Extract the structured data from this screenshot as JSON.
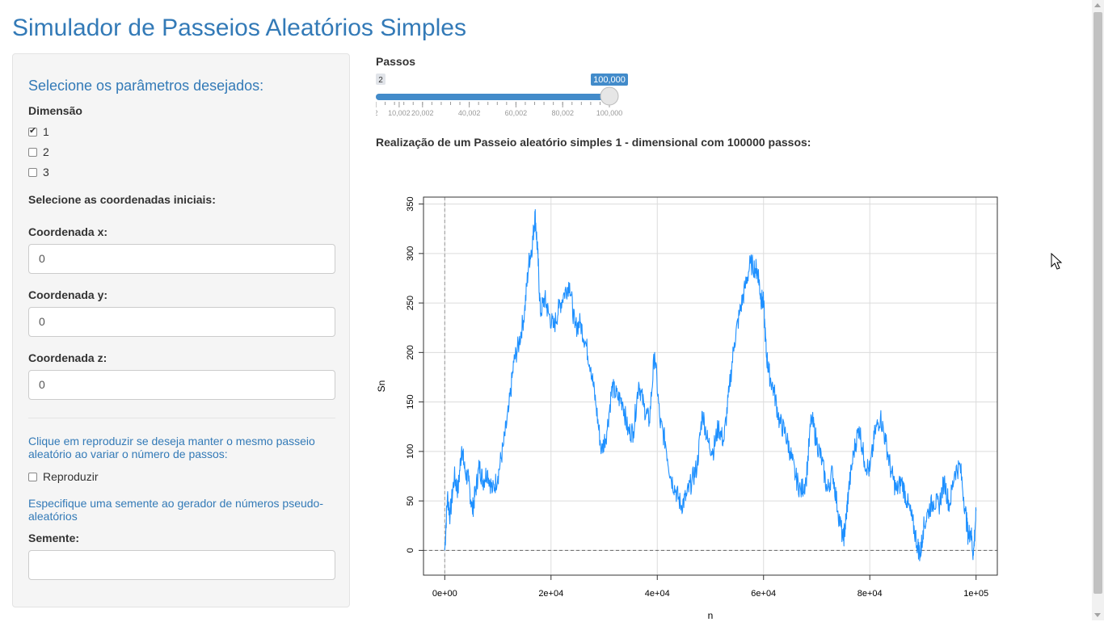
{
  "page": {
    "title": "Simulador de Passeios Aleatórios Simples"
  },
  "sidebar": {
    "heading": "Selecione os parâmetros desejados:",
    "dimension_label": "Dimensão",
    "dimensions": [
      {
        "label": "1",
        "checked": true
      },
      {
        "label": "2",
        "checked": false
      },
      {
        "label": "3",
        "checked": false
      }
    ],
    "coords_heading": "Selecione as coordenadas iniciais:",
    "coord_x": {
      "label": "Coordenada x:",
      "value": "0"
    },
    "coord_y": {
      "label": "Coordenada y:",
      "value": "0"
    },
    "coord_z": {
      "label": "Coordenada z:",
      "value": "0"
    },
    "reproduce_help": "Clique em reproduzir se deseja manter o mesmo passeio aleatório ao variar o número de passos:",
    "reproduce_label": "Reproduzir",
    "seed_help": "Especifique uma semente ao gerador de números pseudo-aleatórios",
    "seed_label": "Semente:",
    "seed_value": ""
  },
  "slider": {
    "label": "Passos",
    "min_badge": "2",
    "value_badge": "100,000",
    "min": 2,
    "max": 100000,
    "value": 100000,
    "accent": "#428bca",
    "ticks": [
      "2",
      "10,002",
      "20,002",
      "40,002",
      "60,002",
      "80,002",
      "100,000"
    ]
  },
  "plot_title": "Realização de um Passeio aleatório simples 1 - dimensional com 100000 passos:",
  "chart_data": {
    "type": "line",
    "xlabel": "n",
    "ylabel": "Sn",
    "xlim": [
      -4000,
      104000
    ],
    "ylim": [
      -25,
      357
    ],
    "x_ticks": [
      "0e+00",
      "2e+04",
      "4e+04",
      "6e+04",
      "8e+04",
      "1e+05"
    ],
    "x_tick_values": [
      0,
      20000,
      40000,
      60000,
      80000,
      100000
    ],
    "y_ticks": [
      "0",
      "50",
      "100",
      "150",
      "200",
      "250",
      "300",
      "350"
    ],
    "y_tick_values": [
      0,
      50,
      100,
      150,
      200,
      250,
      300,
      350
    ],
    "grid": true,
    "reference_lines": {
      "horizontal_dashed_at": 0,
      "vertical_dashed_at": 0
    },
    "color": "#1e90ff",
    "series": [
      {
        "x": [
          0,
          500,
          1000,
          1800,
          2500,
          3200,
          3800,
          4500,
          5200,
          5800,
          6500,
          7200,
          8000,
          9000,
          10000,
          11000,
          12000,
          13000,
          14000,
          15000,
          15800,
          16500,
          17000,
          17500,
          18000,
          18800,
          19500,
          20500,
          21500,
          22500,
          23500,
          24500,
          25500,
          26500,
          27500,
          28500,
          29500,
          30500,
          31500,
          32500,
          33500,
          34500,
          35500,
          36500,
          37500,
          38500,
          39500,
          40500,
          41500,
          42500,
          43500,
          44500,
          45500,
          46500,
          47500,
          48500,
          49500,
          50500,
          51500,
          52500,
          53500,
          54500,
          55500,
          56500,
          57500,
          58500,
          59000,
          59500,
          60000,
          60500,
          61000,
          62000,
          63000,
          64000,
          65000,
          66000,
          67000,
          68000,
          69000,
          70000,
          71000,
          72000,
          73000,
          74000,
          75000,
          75500,
          76000,
          77000,
          78000,
          79000,
          80000,
          81000,
          82000,
          83000,
          84000,
          85000,
          86000,
          87000,
          88000,
          89000,
          89500,
          90000,
          91000,
          92000,
          93000,
          94000,
          95000,
          96000,
          97000,
          98000,
          98500,
          99000,
          99500,
          100000
        ],
        "y": [
          0,
          55,
          35,
          75,
          60,
          105,
          80,
          70,
          40,
          60,
          85,
          70,
          80,
          60,
          75,
          105,
          140,
          190,
          210,
          240,
          290,
          310,
          340,
          300,
          240,
          255,
          240,
          225,
          245,
          260,
          270,
          225,
          230,
          210,
          185,
          145,
          100,
          120,
          165,
          155,
          150,
          120,
          120,
          170,
          145,
          130,
          200,
          130,
          110,
          75,
          60,
          45,
          55,
          70,
          85,
          140,
          110,
          100,
          125,
          110,
          160,
          210,
          240,
          265,
          290,
          285,
          280,
          255,
          250,
          200,
          180,
          160,
          130,
          120,
          100,
          75,
          60,
          70,
          135,
          110,
          90,
          60,
          80,
          40,
          10,
          30,
          60,
          100,
          125,
          90,
          80,
          120,
          135,
          110,
          80,
          60,
          70,
          50,
          30,
          5,
          -5,
          20,
          40,
          50,
          45,
          70,
          45,
          80,
          85,
          40,
          15,
          20,
          -5,
          40
        ]
      }
    ]
  }
}
